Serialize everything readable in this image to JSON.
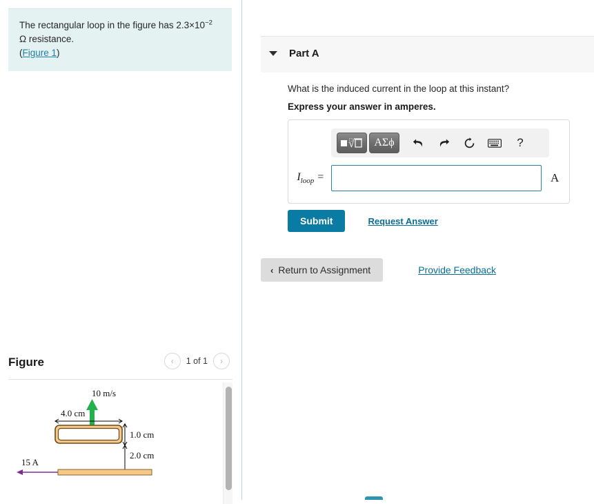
{
  "problem": {
    "text_before": "The rectangular loop in the figure has 2.3×10",
    "exponent": "−2",
    "text_after": " Ω resistance.",
    "figure_link": "Figure 1",
    "open_paren": "(",
    "close_paren": ")"
  },
  "part": {
    "title": "Part A",
    "caret": "caret-down-icon",
    "question": "What is the induced current in the loop at this instant?",
    "instruction": "Express your answer in amperes."
  },
  "answer": {
    "variable": "I",
    "variable_sub": "loop",
    "equals": "=",
    "value": "",
    "placeholder": "",
    "unit": "A",
    "toolbar": {
      "template_label": "■√□",
      "symbols_label": "ΑΣϕ",
      "undo": "↶",
      "redo": "↷",
      "reset": "↻",
      "keyboard": "⌨",
      "help": "?"
    }
  },
  "actions": {
    "submit": "Submit",
    "request_answer": "Request Answer",
    "return_to_assignment": "Return to Assignment",
    "return_chevron": "‹",
    "provide_feedback": "Provide Feedback"
  },
  "figure": {
    "title": "Figure",
    "pager_prev": "‹",
    "pager_next": "›",
    "pager_count": "1 of 1",
    "labels": {
      "velocity": "10 m/s",
      "width": "4.0 cm",
      "height": "1.0 cm",
      "gap": "2.0 cm",
      "current": "15 A"
    },
    "colors": {
      "loop_fill": "#f6c98a",
      "loop_stroke": "#6b4a1e",
      "wire_fill": "#f6c98a",
      "wire_stroke": "#8a6424",
      "velocity_arrow": "#22b14c",
      "current_arrow": "#7b2d8e",
      "dimension_line": "#000000"
    }
  },
  "theme": {
    "problem_bg": "#e4f3f2",
    "accent_teal": "#0a7ca4",
    "link_blue": "#0a6e97",
    "header_bg": "#f7f7f7",
    "input_border": "#2a7f9e"
  }
}
